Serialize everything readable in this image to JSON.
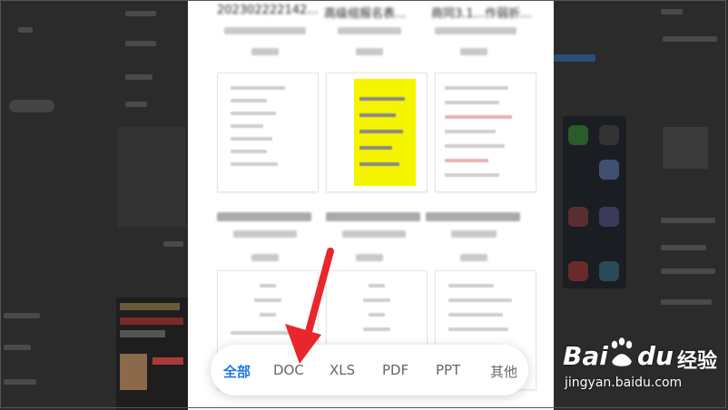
{
  "filter_tabs": [
    {
      "label": "全部",
      "active": true
    },
    {
      "label": "DOC",
      "active": false
    },
    {
      "label": "XLS",
      "active": false
    },
    {
      "label": "PDF",
      "active": false
    },
    {
      "label": "PPT",
      "active": false
    },
    {
      "label": "其他",
      "active": false
    }
  ],
  "files_row1": [
    "202302222142...",
    "高级组报名表...",
    "商同3.1...作弱折..."
  ],
  "watermark": {
    "brand_bai": "Bai",
    "brand_du": "du",
    "brand_cn": "经验",
    "url": "jingyan.baidu.com"
  },
  "colors": {
    "accent": "#1f78e6",
    "arrow": "#e8262b",
    "highlight": "#f5f500"
  }
}
